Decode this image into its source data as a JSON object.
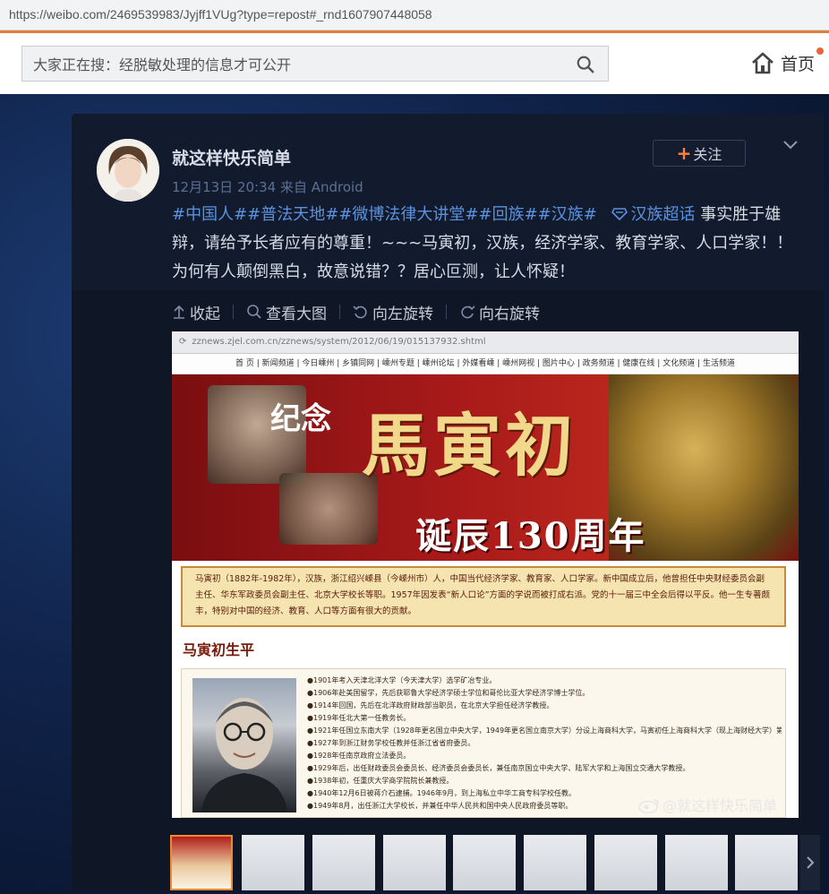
{
  "browser": {
    "url": "https://weibo.com/2469539983/Jyjff1VUg?type=repost#_rnd1607907448058"
  },
  "header": {
    "search_placeholder": "大家正在搜：经脱敏处理的信息才可公开",
    "home_label": "首页",
    "accent_color": "#e27d3c"
  },
  "post": {
    "username": "就这样快乐简单",
    "meta": "12月13日 20:34 来自 Android",
    "follow_label": "关注",
    "tags": "#中国人##普法天地##微博法律大讲堂##回族##汉族#",
    "super_topic": "汉族超话",
    "body": " 事实胜于雄辩，请给予长者应有的尊重！~~~马寅初，汉族，经济学家、教育学家、人口学家！！为何有人颠倒黑白，故意说错？？居心叵测，让人怀疑！",
    "tag_color": "#5b92de"
  },
  "toolbar": {
    "collapse": "收起",
    "view_large": "查看大图",
    "rotate_left": "向左旋转",
    "rotate_right": "向右旋转"
  },
  "image": {
    "address": "zznews.zjel.com.cn/zznews/system/2012/06/19/015137932.shtml",
    "nav": "首 页 | 新闻频道 | 今日嵊州 | 乡镇同网 | 嵊州专题 | 嵊州论坛 | 外媒看嵊 | 嵊州网视 | 图片中心 | 政务频道 | 健康在线 | 文化频道 | 生活频道",
    "banner_prefix": "纪念",
    "banner_title": "馬寅初",
    "banner_subtitle": "诞辰130周年",
    "description": "马寅初（1882年-1982年），汉族，浙江绍兴嵊县（今嵊州市）人，中国当代经济学家、教育家、人口学家。新中国成立后，他曾担任中央财经委员会副主任、华东军政委员会副主任、北京大学校长等职。1957年因发表“新人口论”方面的学说而被打成右派。党的十一届三中全会后得以平反。他一生专著颇丰，特别对中国的经济、教育、人口等方面有很大的贡献。",
    "bio_title": "马寅初生平",
    "bio_items": [
      "●1901年考入天津北洋大学（今天津大学）选学矿冶专业。",
      "●1906年赴美国留学，先后获耶鲁大学经济学硕士学位和哥伦比亚大学经济学博士学位。",
      "●1914年回国，先后在北洋政府财政部当职员，在北京大学担任经济学教授。",
      "●1919年任北大第一任教务长。",
      "●1921年任国立东南大学（1928年更名国立中央大学，1949年更名国立南京大学）分设上海商科大学，马寅初任上海商科大学（现上海财经大学）第一任教务主任，曾兼任中国银行总司券（总发行人）等职。",
      "●1927年到浙江财务学校任教并任浙江省省府委员。",
      "●1928年任南京政府立法委员。",
      "●1929年后，出任财政委员会委员长、经济委员会委员长，兼任南京国立中央大学、陆军大学和上海国立交通大学教授。",
      "●1938年初，任重庆大学商学院院长兼教授。",
      "●1940年12月6日被蒋介石逮捕。1946年9月，到上海私立中华工商专科学校任教。",
      "●1949年8月，出任浙江大学校长，并兼任中华人民共和国中央人民政府委员等职。"
    ],
    "watermark": "@就这样快乐简单"
  }
}
